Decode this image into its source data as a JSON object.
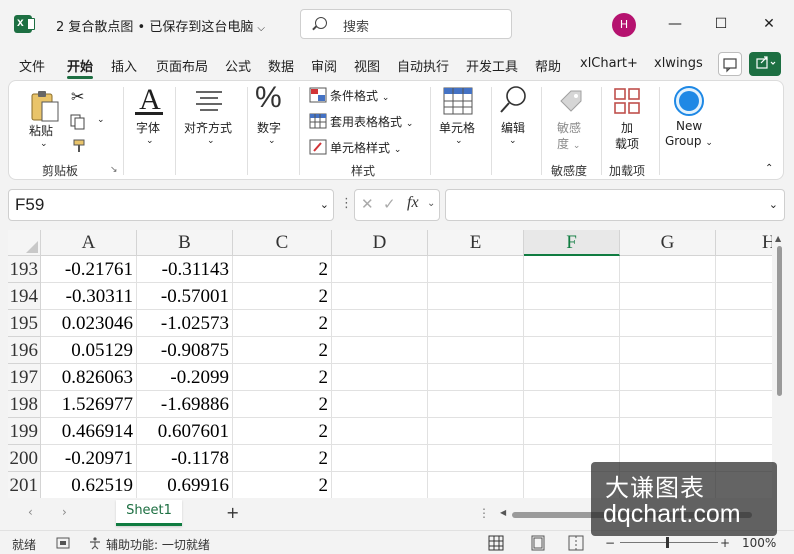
{
  "window": {
    "title": "2 复合散点图 • 已保存到这台电脑",
    "search_placeholder": "搜索",
    "avatar_initial": "H",
    "minimize": "—",
    "maximize": "☐",
    "close": "✕"
  },
  "ribbon_tabs": [
    "文件",
    "开始",
    "插入",
    "页面布局",
    "公式",
    "数据",
    "审阅",
    "视图",
    "自动执行",
    "开发工具",
    "帮助",
    "xlChart+",
    "xlwings"
  ],
  "ribbon": {
    "clipboard": {
      "paste": "粘贴",
      "group": "剪贴板"
    },
    "font": {
      "label": "字体"
    },
    "alignment": {
      "label": "对齐方式"
    },
    "number": {
      "label": "数字"
    },
    "styles": {
      "conditional": "条件格式",
      "table": "套用表格格式",
      "cell": "单元格样式",
      "group": "样式"
    },
    "cells": {
      "label": "单元格"
    },
    "editing": {
      "label": "编辑"
    },
    "sensitivity": {
      "label_line1": "敏感",
      "label_line2": "度",
      "group": "敏感度"
    },
    "addins": {
      "label_line1": "加",
      "label_line2": "载项",
      "group": "加载项"
    },
    "new_group": {
      "line1": "New",
      "line2": "Group"
    }
  },
  "formula_bar": {
    "name_box": "F59",
    "fx": "fx",
    "value": ""
  },
  "columns": [
    "A",
    "B",
    "C",
    "D",
    "E",
    "F",
    "G",
    "H"
  ],
  "selected_column": "F",
  "rows": [
    {
      "num": "193",
      "a": "-0.21761",
      "b": "-0.31143",
      "c": "2"
    },
    {
      "num": "194",
      "a": "-0.30311",
      "b": "-0.57001",
      "c": "2"
    },
    {
      "num": "195",
      "a": "0.023046",
      "b": "-1.02573",
      "c": "2"
    },
    {
      "num": "196",
      "a": "0.05129",
      "b": "-0.90875",
      "c": "2"
    },
    {
      "num": "197",
      "a": "0.826063",
      "b": "-0.2099",
      "c": "2"
    },
    {
      "num": "198",
      "a": "1.526977",
      "b": "-1.69886",
      "c": "2"
    },
    {
      "num": "199",
      "a": "0.466914",
      "b": "0.607601",
      "c": "2"
    },
    {
      "num": "200",
      "a": "-0.20971",
      "b": "-0.1178",
      "c": "2"
    },
    {
      "num": "201",
      "a": "0.62519",
      "b": "0.69916",
      "c": "2"
    }
  ],
  "sheet_tab": "Sheet1",
  "status": {
    "ready": "就绪",
    "accessibility": "辅助功能: 一切就绪",
    "zoom": "100%"
  },
  "watermark": {
    "line1": "大谦图表",
    "line2": "dqchart.com"
  },
  "colors": {
    "excel_green": "#107c41",
    "avatar": "#b5126f",
    "new_group_icon": "#1e88e5"
  }
}
